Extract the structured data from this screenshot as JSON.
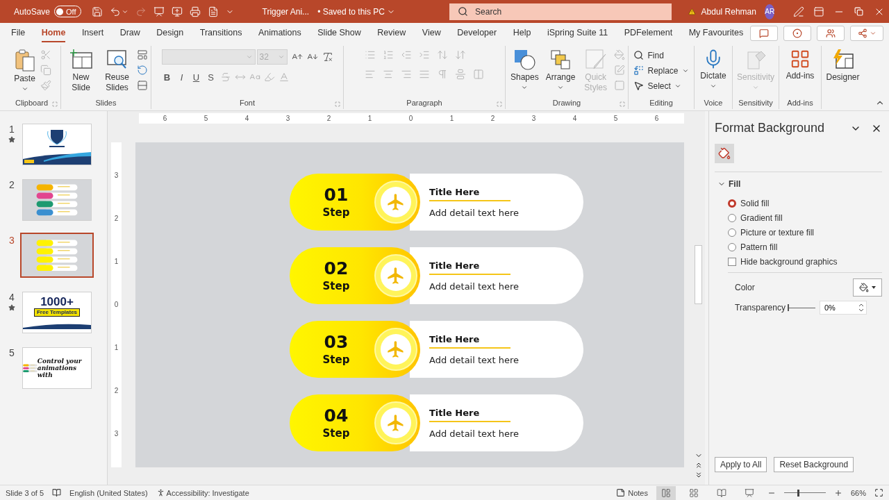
{
  "title_bar": {
    "autosave_label": "AutoSave",
    "autosave": {
      "label": "Off",
      "on": false
    },
    "document": "Trigger Ani...",
    "save_status": "• Saved to this PC",
    "search_placeholder": "Search",
    "user": "Abdul Rehman",
    "avatar": "AR"
  },
  "menu_tabs": [
    {
      "label": "File",
      "selected": false
    },
    {
      "label": "Home",
      "selected": true
    },
    {
      "label": "Insert",
      "selected": false
    },
    {
      "label": "Draw",
      "selected": false
    },
    {
      "label": "Design",
      "selected": false
    },
    {
      "label": "Transitions",
      "selected": false
    },
    {
      "label": "Animations",
      "selected": false
    },
    {
      "label": "Slide Show",
      "selected": false
    },
    {
      "label": "Review",
      "selected": false
    },
    {
      "label": "View",
      "selected": false
    },
    {
      "label": "Developer",
      "selected": false
    },
    {
      "label": "Help",
      "selected": false
    },
    {
      "label": "iSpring Suite 11",
      "selected": false
    },
    {
      "label": "PDFelement",
      "selected": false
    },
    {
      "label": "My Favourites",
      "selected": false
    }
  ],
  "ribbon": {
    "groups": [
      {
        "kind": "clipboard",
        "label": "Clipboard",
        "buttons": [
          {
            "label": "Paste",
            "disabled": false
          }
        ]
      },
      {
        "kind": "slides",
        "label": "Slides",
        "buttons": [
          {
            "label": "New Slide",
            "disabled": false
          },
          {
            "label": "Reuse Slides",
            "disabled": false
          }
        ]
      },
      {
        "kind": "font",
        "label": "Font",
        "font_size": "32",
        "format_keys": [
          "B",
          "I",
          "U",
          "S"
        ]
      },
      {
        "kind": "paragraph",
        "label": "Paragraph"
      },
      {
        "kind": "drawing",
        "label": "Drawing",
        "buttons": [
          {
            "label": "Shapes",
            "disabled": false
          },
          {
            "label": "Arrange",
            "disabled": false
          },
          {
            "label": "Quick Styles",
            "disabled": true
          }
        ]
      },
      {
        "kind": "editing",
        "label": "Editing",
        "buttons": [
          {
            "label": "Find"
          },
          {
            "label": "Replace"
          },
          {
            "label": "Select"
          }
        ]
      },
      {
        "kind": "voice",
        "label": "Voice",
        "buttons": [
          {
            "label": "Dictate",
            "disabled": false
          }
        ]
      },
      {
        "kind": "sensitivity",
        "label": "Sensitivity",
        "buttons": [
          {
            "label": "Sensitivity",
            "disabled": true
          }
        ]
      },
      {
        "kind": "addins",
        "label": "Add-ins",
        "buttons": [
          {
            "label": "Add-ins",
            "disabled": false
          }
        ]
      },
      {
        "kind": "designer",
        "buttons": [
          {
            "label": "Designer",
            "disabled": false
          }
        ]
      }
    ]
  },
  "slides": [
    {
      "number": "1",
      "starred": true,
      "selected": false,
      "kind": "cover"
    },
    {
      "number": "2",
      "starred": false,
      "selected": false,
      "kind": "steps-color"
    },
    {
      "number": "3",
      "starred": false,
      "selected": true,
      "kind": "steps-yellow"
    },
    {
      "number": "4",
      "starred": true,
      "selected": false,
      "kind": "promo",
      "texts": [
        "1000+",
        "Free Templates"
      ]
    },
    {
      "number": "5",
      "starred": false,
      "selected": false,
      "kind": "handwritten",
      "texts": [
        "Control your animations with"
      ]
    }
  ],
  "rulers": {
    "horizontal": [
      "6",
      "5",
      "4",
      "3",
      "2",
      "1",
      "0",
      "1",
      "2",
      "3",
      "4",
      "5",
      "6"
    ],
    "vertical": [
      "3",
      "2",
      "1",
      "0",
      "1",
      "2",
      "3"
    ]
  },
  "slide": {
    "steps": [
      {
        "number": "01",
        "step": "Step",
        "title": "Title Here",
        "detail": "Add detail text here"
      },
      {
        "number": "02",
        "step": "Step",
        "title": "Title Here",
        "detail": "Add detail text here"
      },
      {
        "number": "03",
        "step": "Step",
        "title": "Title Here",
        "detail": "Add detail text here"
      },
      {
        "number": "04",
        "step": "Step",
        "title": "Title Here",
        "detail": "Add detail text here"
      }
    ]
  },
  "format_pane": {
    "title": "Format Background",
    "fill": {
      "label": "Fill",
      "expanded": true
    },
    "options": [
      {
        "label": "Solid fill",
        "selected": true
      },
      {
        "label": "Gradient fill",
        "selected": false
      },
      {
        "label": "Picture or texture fill",
        "selected": false
      },
      {
        "label": "Pattern fill",
        "selected": false
      }
    ],
    "hide_graphics": {
      "label": "Hide background graphics",
      "checked": false
    },
    "color_label": "Color",
    "transparency": {
      "label": "Transparency",
      "value": "0%",
      "level": 0
    },
    "buttons": [
      "Apply to All",
      "Reset Background"
    ]
  },
  "status_bar": {
    "slide": "Slide 3 of 5",
    "language": "English (United States)",
    "accessibility": "Accessibility: Investigate",
    "notes": "Notes",
    "views": [
      {
        "selected": true
      },
      {
        "selected": false
      },
      {
        "selected": false
      },
      {
        "selected": false
      }
    ],
    "zoom_slider": {
      "level": 0.33
    },
    "zoom": "66%"
  }
}
